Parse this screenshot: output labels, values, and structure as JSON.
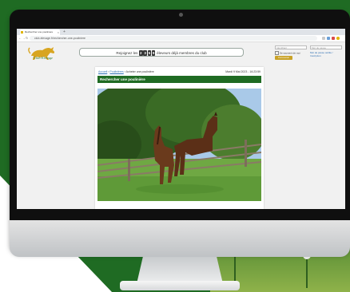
{
  "browser": {
    "tab_title": "Rechercher une pouliniere",
    "new_tab": "+",
    "url": "club-elevage.fr/rechercher-une-pouliniere",
    "back": "←",
    "forward": "→",
    "reload": "↻"
  },
  "site": {
    "logo_text": "Club Elevage",
    "counter": {
      "prefix": "Rejoignez les",
      "digits": [
        "2",
        "3",
        "5",
        "9"
      ],
      "suffix": "éleveurs déjà membres du club"
    },
    "login": {
      "email_placeholder": "Identifiant",
      "password_placeholder": "Mot de passe",
      "remember_label": "Se souvenir de moi",
      "forgot_label": "Mot de passe oublié / Inscription",
      "submit_label": "Connexion"
    }
  },
  "content": {
    "breadcrumb": {
      "home": "Accueil",
      "section": "Poulinières",
      "sep": " › ",
      "current": "Acheter une poulinière"
    },
    "datetime": "Mardi 9 Mai 2023 - 16:23:59",
    "title": "Rechercher une poulinière"
  },
  "colors": {
    "brand_green": "#1f6b23",
    "gold": "#c9a227",
    "link_blue": "#2e6fb3"
  }
}
